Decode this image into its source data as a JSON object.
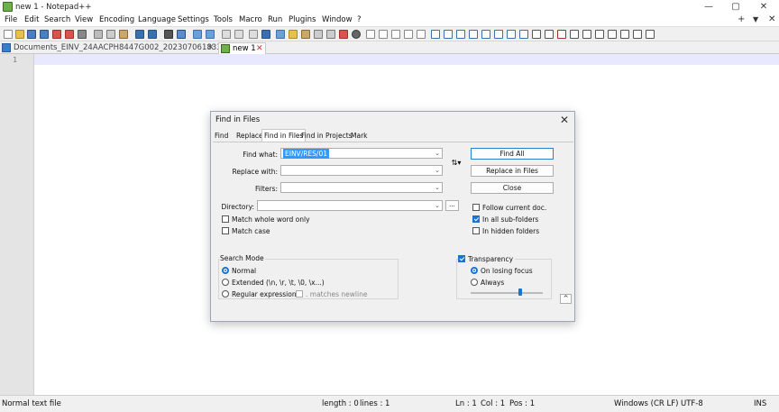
{
  "window": {
    "title": "new 1 - Notepad++"
  },
  "menu": [
    "File",
    "Edit",
    "Search",
    "View",
    "Encoding",
    "Language",
    "Settings",
    "Tools",
    "Macro",
    "Run",
    "Plugins",
    "Window",
    "?"
  ],
  "menu_right": {
    "plus": "+",
    "dropdown": "▼",
    "close": "✕"
  },
  "window_controls": {
    "minimize": "—",
    "maximize": "▢",
    "close": "✕"
  },
  "tabs": [
    {
      "label": "Documents_EINV_24AACPH8447G002_202307061833.json",
      "close": "✕"
    },
    {
      "label": "new 1",
      "close": "✕"
    }
  ],
  "editor": {
    "line_number": "1"
  },
  "status": {
    "file_type": "Normal text file",
    "length": "length : 0",
    "lines": "lines : 1",
    "ln": "Ln : 1",
    "col": "Col : 1",
    "pos": "Pos : 1",
    "eol": "Windows (CR LF)",
    "encoding": "UTF-8",
    "mode": "INS"
  },
  "dialog": {
    "title": "Find in Files",
    "close": "✕",
    "tabs": [
      "Find",
      "Replace",
      "Find in Files",
      "Find in Projects",
      "Mark"
    ],
    "labels": {
      "find_what": "Find what:",
      "replace_with": "Replace with:",
      "filters": "Filters:",
      "directory": "Directory:"
    },
    "find_what_value": "EINV/RES/01",
    "swap_glyph": "⇅▾",
    "browse": "...",
    "buttons": {
      "find_all": "Find All",
      "replace_in_files": "Replace in Files",
      "close": "Close"
    },
    "options": {
      "match_whole_word": "Match whole word only",
      "match_case": "Match case",
      "follow_current_doc": "Follow current doc.",
      "in_all_sub_folders": "In all sub-folders",
      "in_hidden_folders": "In hidden folders"
    },
    "search_mode": {
      "label": "Search Mode",
      "normal": "Normal",
      "extended": "Extended (\\n, \\r, \\t, \\0, \\x...)",
      "regex": "Regular expression",
      "matches_newline": ". matches newline"
    },
    "transparency": {
      "label": "Transparency",
      "on_losing_focus": "On losing focus",
      "always": "Always",
      "level": 0.7
    },
    "collapse_glyph": "^"
  }
}
